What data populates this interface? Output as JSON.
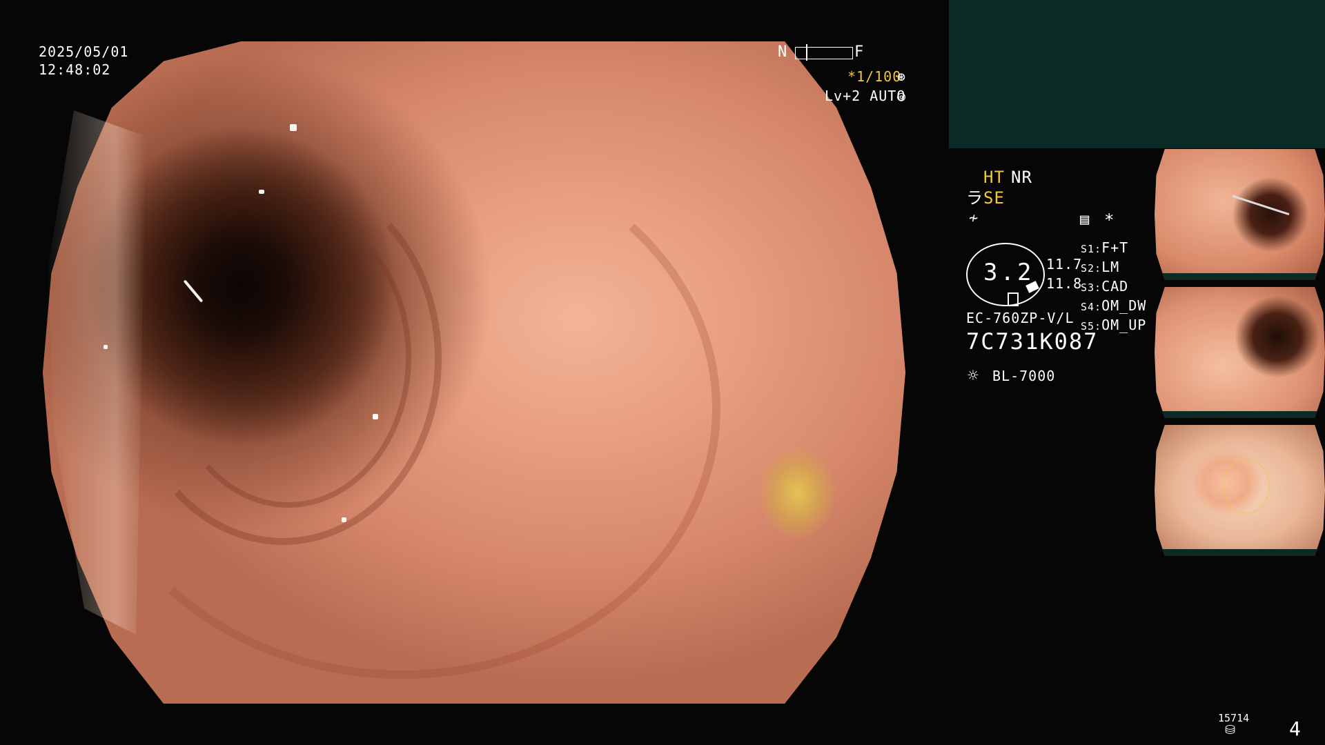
{
  "datetime": {
    "date": "2025/05/01",
    "time": "12:48:02"
  },
  "scale": {
    "near": "N",
    "far": "F"
  },
  "shutter": {
    "value": "*1/100",
    "icon": "aperture-icon"
  },
  "iris": {
    "value": "Lv+2 AUTO",
    "icon": "iris-icon"
  },
  "enhance": {
    "ht": "HT",
    "nr": "NR",
    "se_prefix": "ラ",
    "se": "SE",
    "wave_icon": "freeze-icon",
    "chart_icon": "record-icon",
    "star": "*"
  },
  "dial": {
    "value": "3.2"
  },
  "readings": {
    "top": "11.7",
    "bottom": "11.8"
  },
  "modes": [
    {
      "key": "S1:",
      "value": "F+T"
    },
    {
      "key": "S2:",
      "value": "LM"
    },
    {
      "key": "S3:",
      "value": "CAD"
    },
    {
      "key": "S4:",
      "value": "OM_DW"
    },
    {
      "key": "S5:",
      "value": "OM_UP"
    }
  ],
  "scope": {
    "model": "EC-760ZP-V/L",
    "serial": "7C731K087"
  },
  "light": {
    "icon": "light-source-icon",
    "model": "BL-7000"
  },
  "footer": {
    "counter": "15714",
    "storage_icon": "storage-icon",
    "page": "4"
  },
  "colors": {
    "accent": "#f5c638",
    "panel": "#0c2a26",
    "text": "#ffffff"
  }
}
